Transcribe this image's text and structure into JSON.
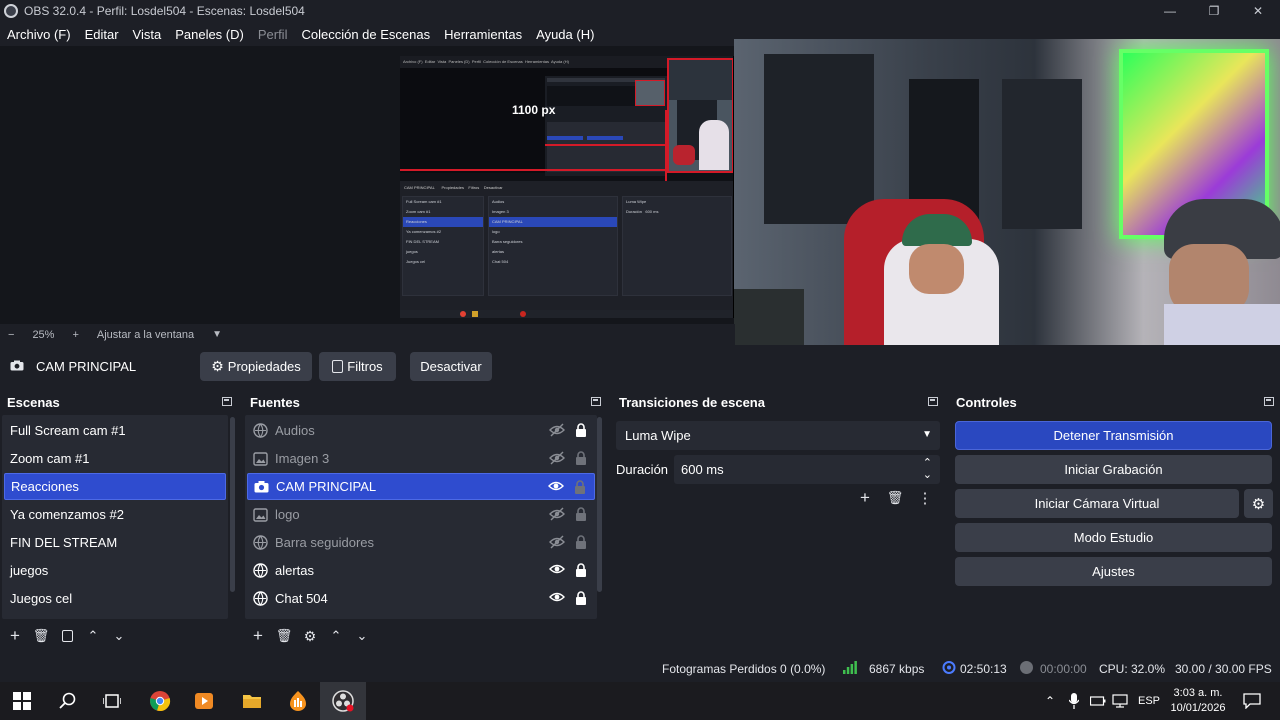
{
  "window": {
    "title": "OBS 32.0.4 - Perfil: Losdel504 - Escenas: Losdel504",
    "minimize_icon": "minimize-icon",
    "maximize_icon": "restore-icon",
    "close_icon": "close-icon"
  },
  "menu": {
    "items": [
      "Archivo (F)",
      "Editar",
      "Vista",
      "Paneles (D)",
      "Perfil",
      "Colección de Escenas",
      "Herramientas",
      "Ayuda (H)"
    ]
  },
  "preview": {
    "nested_label": "1100 px",
    "zoom_minus": "−",
    "zoom_value": "25%",
    "zoom_plus": "+",
    "zoom_mode": "Ajustar a la ventana"
  },
  "source_toolbar": {
    "source_name": "CAM PRINCIPAL",
    "properties_label": "Propiedades",
    "filters_label": "Filtros",
    "deactivate_label": "Desactivar"
  },
  "scenes": {
    "title": "Escenas",
    "items": [
      {
        "label": "Full Scream cam #1",
        "selected": false
      },
      {
        "label": "Zoom cam #1",
        "selected": false
      },
      {
        "label": "Reacciones",
        "selected": true
      },
      {
        "label": "Ya comenzamos #2",
        "selected": false
      },
      {
        "label": "FIN DEL STREAM",
        "selected": false
      },
      {
        "label": "juegos",
        "selected": false
      },
      {
        "label": "Juegos cel",
        "selected": false
      }
    ]
  },
  "sources": {
    "title": "Fuentes",
    "items": [
      {
        "label": "Audios",
        "icon": "browser-source-icon",
        "visible": false,
        "locked": true
      },
      {
        "label": "Imagen 3",
        "icon": "image-source-icon",
        "visible": false,
        "locked": false
      },
      {
        "label": "CAM PRINCIPAL",
        "icon": "camera-source-icon",
        "visible": true,
        "locked": false,
        "selected": true
      },
      {
        "label": "logo",
        "icon": "image-source-icon",
        "visible": false,
        "locked": false
      },
      {
        "label": "Barra seguidores",
        "icon": "browser-source-icon",
        "visible": false,
        "locked": false
      },
      {
        "label": "alertas",
        "icon": "browser-source-icon",
        "visible": true,
        "locked": true
      },
      {
        "label": "Chat 504",
        "icon": "browser-source-icon",
        "visible": true,
        "locked": true
      }
    ]
  },
  "transitions": {
    "title": "Transiciones de escena",
    "selected": "Luma Wipe",
    "duration_label": "Duración",
    "duration_value": "600 ms"
  },
  "controls": {
    "title": "Controles",
    "stop_stream": "Detener Transmisión",
    "start_recording": "Iniciar Grabación",
    "virtual_camera": "Iniciar Cámara Virtual",
    "studio_mode": "Modo Estudio",
    "settings": "Ajustes"
  },
  "status": {
    "dropped_frames": "Fotogramas Perdidos 0 (0.0%)",
    "bitrate": "6867 kbps",
    "stream_time": "02:50:13",
    "record_time": "00:00:00",
    "cpu": "CPU: 32.0%",
    "fps": "30.00 / 30.00 FPS"
  },
  "taskbar": {
    "language": "ESP",
    "time": "3:03 a. m.",
    "date": "10/01/2026"
  },
  "colors": {
    "accent": "#2f4ccf",
    "stream_active": "#2a48c0",
    "bitrate_ok": "#3fbf4f",
    "record_dot": "#6b6e75"
  }
}
